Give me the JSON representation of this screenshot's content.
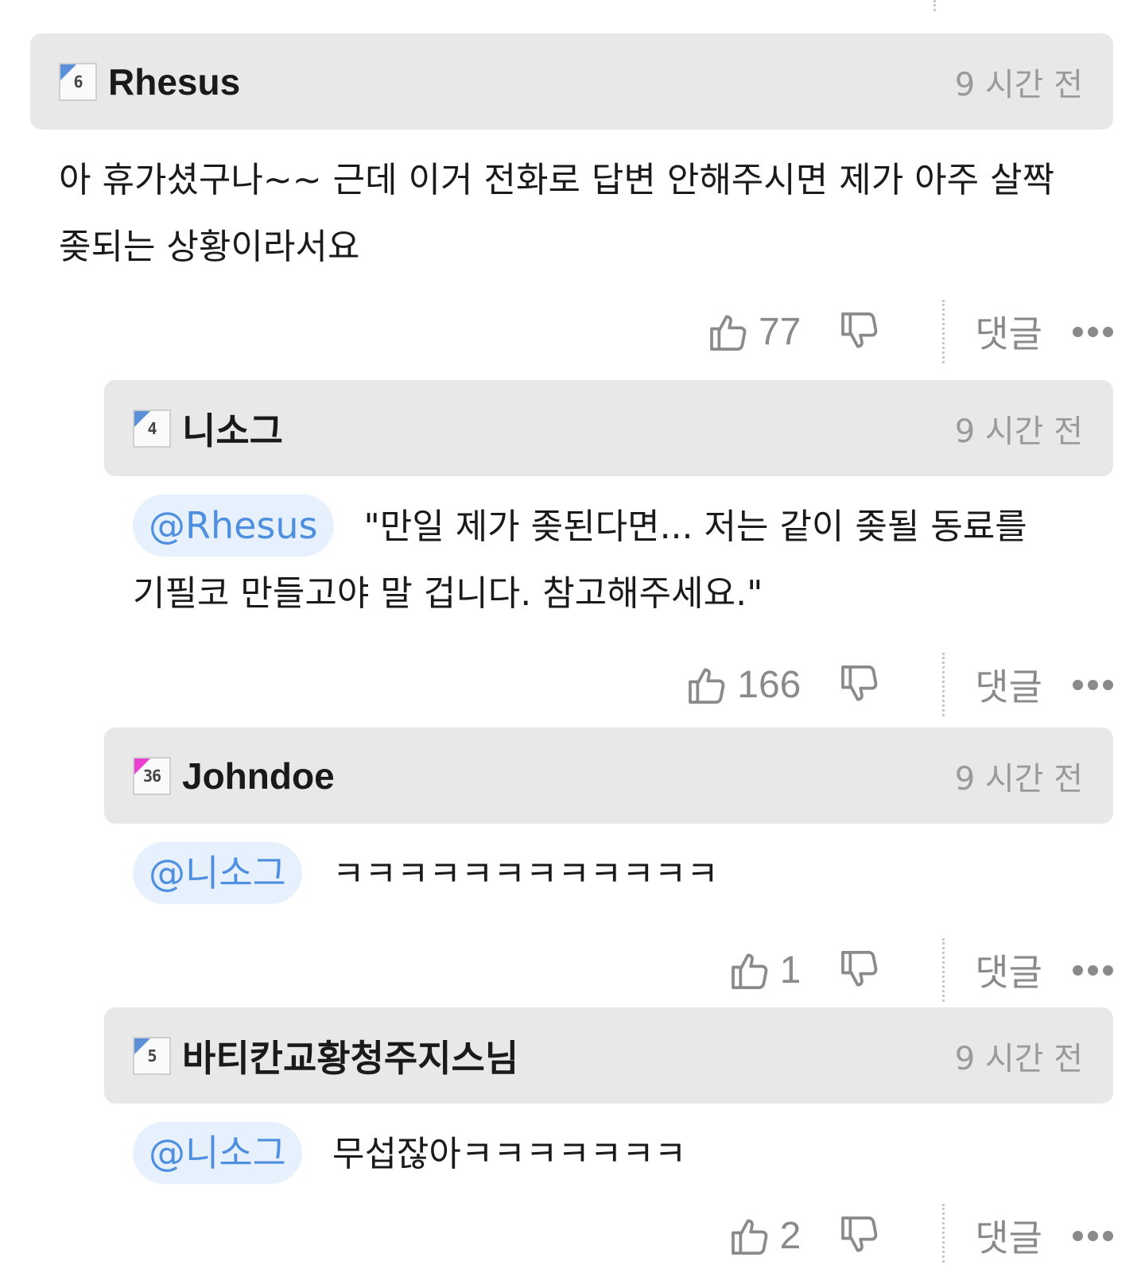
{
  "comments": [
    {
      "username": "Rhesus",
      "level": "6",
      "time": "9 시간 전",
      "mention": "",
      "text": "아 휴가셨구나~~ 근데 이거 전화로 답변 안해주시면 제가 아주 살짝 좆되는 상황이라서요",
      "likes": "77",
      "reply_label": "댓글"
    },
    {
      "username": "니소그",
      "level": "4",
      "time": "9 시간 전",
      "mention": "@Rhesus",
      "text": "\"만일 제가 좆된다면... 저는 같이 좆될 동료를 기필코 만들고야 말 겁니다. 참고해주세요.\"",
      "likes": "166",
      "reply_label": "댓글"
    },
    {
      "username": "Johndoe",
      "level": "36",
      "time": "9 시간 전",
      "mention": "@니소그",
      "text": "ㅋㅋㅋㅋㅋㅋㅋㅋㅋㅋㅋㅋ",
      "likes": "1",
      "reply_label": "댓글"
    },
    {
      "username": "바티칸교황청주지스님",
      "level": "5",
      "time": "9 시간 전",
      "mention": "@니소그",
      "text": "무섭잖아ㅋㅋㅋㅋㅋㅋㅋ",
      "likes": "2",
      "reply_label": "댓글"
    }
  ],
  "icons": {
    "like": "thumbs-up-icon",
    "dislike": "thumbs-down-icon",
    "more": "more-dots-icon",
    "level_badge": "level-badge-icon"
  },
  "colors": {
    "header_bg": "#e8e8e8",
    "mention_bg": "#e7f1fd",
    "mention_text": "#4f8fe0",
    "badge_blue": "#5b8fd8",
    "badge_pink": "#ea3ecf",
    "muted_text": "#8a8a8a"
  }
}
